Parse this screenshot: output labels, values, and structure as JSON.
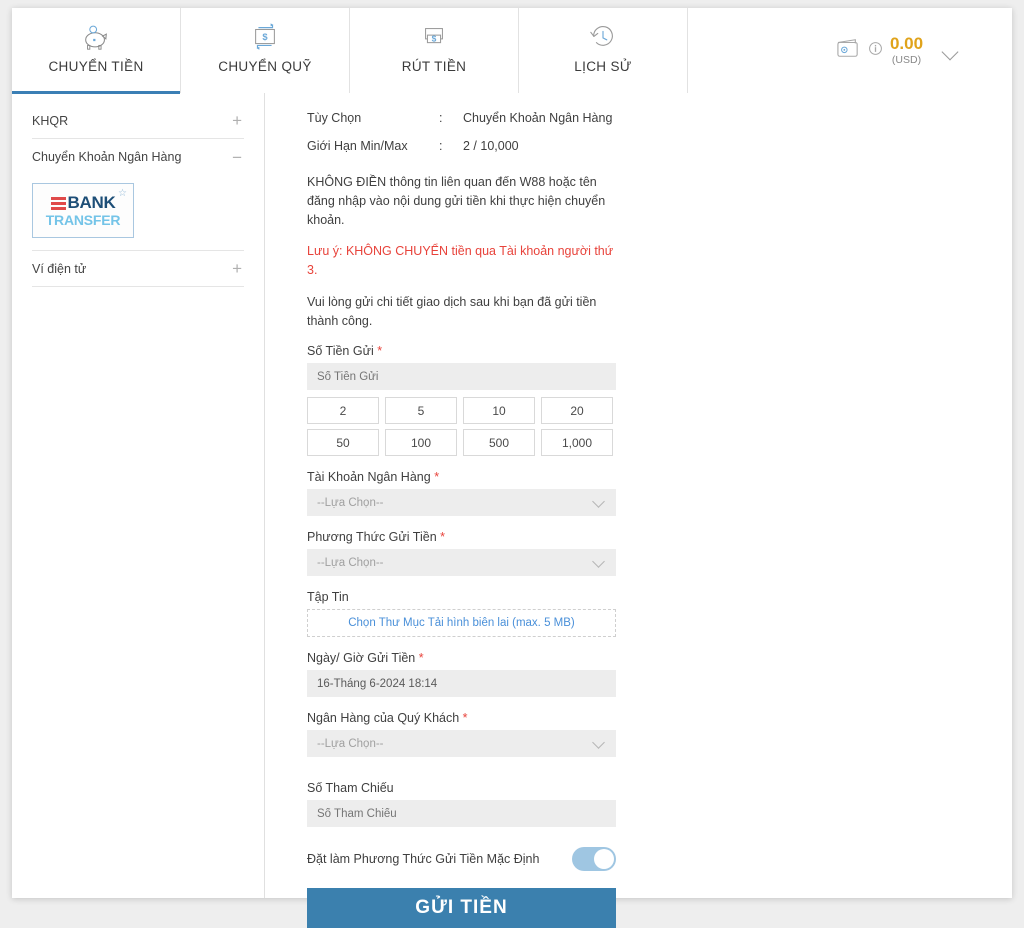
{
  "tabs": [
    {
      "label": "CHUYỂN TIỀN",
      "icon": "piggy-bank-icon",
      "active": true
    },
    {
      "label": "CHUYỂN QUỸ",
      "icon": "transfer-funds-icon",
      "active": false
    },
    {
      "label": "RÚT TIỀN",
      "icon": "withdraw-cash-icon",
      "active": false
    },
    {
      "label": "LỊCH SỬ",
      "icon": "history-clock-icon",
      "active": false
    }
  ],
  "wallet": {
    "icon": "wallet-icon",
    "info_icon": "info-icon",
    "amount": "0.00",
    "currency": "(USD)",
    "chevron": "chevron-down-icon"
  },
  "sidebar": {
    "items": [
      {
        "label": "KHQR",
        "toggle": "+"
      },
      {
        "label": "Chuyển Khoản Ngân Hàng",
        "toggle": "−"
      },
      {
        "label": "Ví điện tử",
        "toggle": "+"
      }
    ],
    "bank_logo": {
      "line1": "BANK",
      "line2": "TRANSFER",
      "star": "☆"
    }
  },
  "main": {
    "info_rows": [
      {
        "key": "Tùy Chọn",
        "colon": ":",
        "value": "Chuyển Khoản Ngân Hàng"
      },
      {
        "key": "Giới Hạn Min/Max",
        "colon": ":",
        "value": "2 / 10,000"
      }
    ],
    "note1": "KHÔNG ĐIỀN thông tin liên quan đến W88 hoặc tên đăng nhập vào nội dung gửi tiền khi thực hiện chuyển khoản.",
    "note_warning": "Lưu ý: KHÔNG CHUYỂN tiền qua Tài khoản người thứ 3.",
    "note2": "Vui lòng gửi chi tiết giao dịch sau khi bạn đã gửi tiền thành công.",
    "amount_label": "Số Tiền Gửi",
    "amount_placeholder": "Số Tiền Gửi",
    "amount_value": "",
    "quick_amounts": [
      "2",
      "5",
      "10",
      "20",
      "50",
      "100",
      "500",
      "1,000"
    ],
    "bank_account_label": "Tài Khoản Ngân Hàng",
    "bank_account_value": "--Lựa Chọn--",
    "deposit_method_label": "Phương Thức Gửi Tiền",
    "deposit_method_value": "--Lựa Chọn--",
    "file_label": "Tập Tin",
    "file_button": "Chọn Thư Mục Tải hình biên lai (max. 5 MB)",
    "datetime_label": "Ngày/ Giờ Gửi Tiền",
    "datetime_value": "16-Tháng 6-2024 18:14",
    "your_bank_label": "Ngân Hàng của Quý Khách",
    "your_bank_value": "--Lựa Chọn--",
    "reference_label": "Số Tham Chiếu",
    "reference_placeholder": "Số Tham Chiếu",
    "reference_value": "",
    "default_toggle_label": "Đặt làm Phương Thức Gửi Tiền Mặc Định",
    "default_toggle_on": true,
    "submit_label": "GỬI TIỀN",
    "required_mark": "*"
  },
  "colors": {
    "accent": "#3b80ae",
    "warning": "#e8433b",
    "amount": "#e0a31b",
    "link": "#4a90d9",
    "bank_blue": "#1d4e77",
    "transfer_blue": "#74c4e8",
    "bank_red": "#e04a4a"
  }
}
